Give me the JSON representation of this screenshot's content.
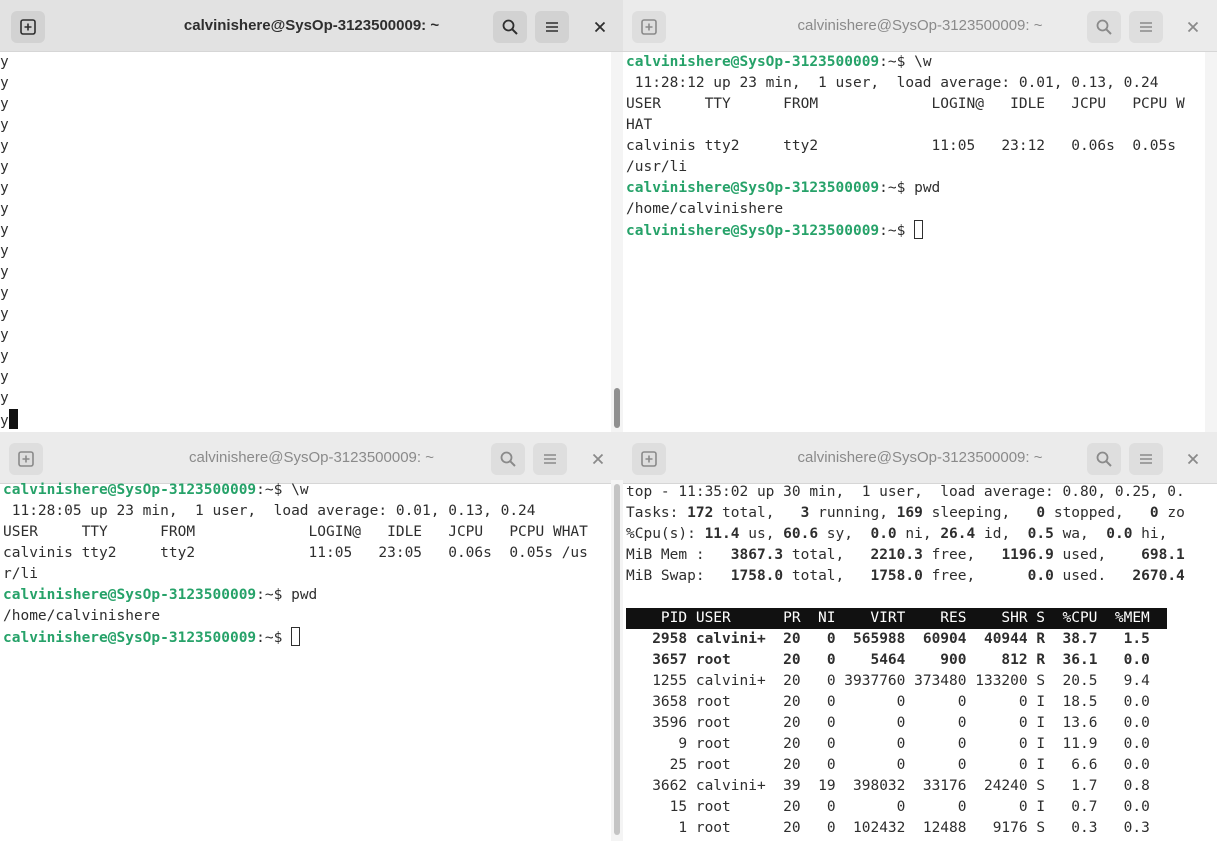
{
  "colors": {
    "prompt": "#26a269",
    "titlebar_active": "#e2e2e2",
    "titlebar_inactive": "#ebebeb",
    "desktop": "#2b2b5a"
  },
  "windows": {
    "top_left": {
      "title": "calvinishere@SysOp-3123500009: ~",
      "active": true,
      "lines": [
        "y",
        "y",
        "y",
        "y",
        "y",
        "y",
        "y",
        "y",
        "y",
        "y",
        "y",
        "y",
        "y",
        "y",
        "y",
        "y",
        "y"
      ],
      "last_line": "y",
      "scroll_position": 0.98
    },
    "top_right": {
      "title": "calvinishere@SysOp-3123500009: ~",
      "active": false,
      "prompt": "calvinishere@SysOp-3123500009",
      "lines": [
        {
          "p": "calvinishere@SysOp-3123500009",
          "t": ":~$ \\w"
        },
        {
          "t": " 11:28:12 up 23 min,  1 user,  load average: 0.01, 0.13, 0.24"
        },
        {
          "t": "USER     TTY      FROM             LOGIN@   IDLE   JCPU   PCPU W"
        },
        {
          "t": "HAT"
        },
        {
          "t": "calvinis tty2     tty2             11:05   23:12   0.06s  0.05s"
        },
        {
          "t": "/usr/li"
        },
        {
          "p": "calvinishere@SysOp-3123500009",
          "t": ":~$ pwd"
        },
        {
          "t": "/home/calvinishere"
        },
        {
          "p": "calvinishere@SysOp-3123500009",
          "t": ":~$ ",
          "cursor": true
        }
      ]
    },
    "bottom_left": {
      "title": "calvinishere@SysOp-3123500009: ~",
      "active": false,
      "lines": [
        {
          "p": "calvinishere@SysOp-3123500009",
          "t": ":~$ \\w"
        },
        {
          "t": " 11:28:05 up 23 min,  1 user,  load average: 0.01, 0.13, 0.24"
        },
        {
          "t": "USER     TTY      FROM             LOGIN@   IDLE   JCPU   PCPU WHAT"
        },
        {
          "t": "calvinis tty2     tty2             11:05   23:05   0.06s  0.05s /us"
        },
        {
          "t": "r/li"
        },
        {
          "p": "calvinishere@SysOp-3123500009",
          "t": ":~$ pwd"
        },
        {
          "t": "/home/calvinishere"
        },
        {
          "p": "calvinishere@SysOp-3123500009",
          "t": ":~$ ",
          "cursor": true
        }
      ]
    },
    "bottom_right": {
      "title": "calvinishere@SysOp-3123500009: ~",
      "active": false,
      "summary": [
        [
          {
            "t": "top - 11:35:02 up 30 min,  1 user,  load average: 0.80, 0.25, 0."
          }
        ],
        [
          {
            "t": "Tasks: "
          },
          {
            "t": "172",
            "b": true
          },
          {
            "t": " total,   "
          },
          {
            "t": "3",
            "b": true
          },
          {
            "t": " running, "
          },
          {
            "t": "169",
            "b": true
          },
          {
            "t": " sleeping,   "
          },
          {
            "t": "0",
            "b": true
          },
          {
            "t": " stopped,   "
          },
          {
            "t": "0",
            "b": true
          },
          {
            "t": " zo"
          }
        ],
        [
          {
            "t": "%Cpu(s): "
          },
          {
            "t": "11.4",
            "b": true
          },
          {
            "t": " us, "
          },
          {
            "t": "60.6",
            "b": true
          },
          {
            "t": " sy,  "
          },
          {
            "t": "0.0",
            "b": true
          },
          {
            "t": " ni, "
          },
          {
            "t": "26.4",
            "b": true
          },
          {
            "t": " id,  "
          },
          {
            "t": "0.5",
            "b": true
          },
          {
            "t": " wa,  "
          },
          {
            "t": "0.0",
            "b": true
          },
          {
            "t": " hi,"
          }
        ],
        [
          {
            "t": "MiB Mem :   "
          },
          {
            "t": "3867.3",
            "b": true
          },
          {
            "t": " total,   "
          },
          {
            "t": "2210.3",
            "b": true
          },
          {
            "t": " free,   "
          },
          {
            "t": "1196.9",
            "b": true
          },
          {
            "t": " used,    "
          },
          {
            "t": "698.1",
            "b": true
          }
        ],
        [
          {
            "t": "MiB Swap:   "
          },
          {
            "t": "1758.0",
            "b": true
          },
          {
            "t": " total,   "
          },
          {
            "t": "1758.0",
            "b": true
          },
          {
            "t": " free,      "
          },
          {
            "t": "0.0",
            "b": true
          },
          {
            "t": " used.   "
          },
          {
            "t": "2670.4",
            "b": true
          }
        ],
        []
      ],
      "table_header": "    PID USER      PR  NI    VIRT    RES    SHR S  %CPU  %MEM  ",
      "processes": [
        {
          "pid": "2958",
          "user": "calvini+",
          "pr": "20",
          "ni": "0",
          "virt": "565988",
          "res": "60904",
          "shr": "40944",
          "s": "R",
          "cpu": "38.7",
          "mem": "1.5",
          "bold": true
        },
        {
          "pid": "3657",
          "user": "root",
          "pr": "20",
          "ni": "0",
          "virt": "5464",
          "res": "900",
          "shr": "812",
          "s": "R",
          "cpu": "36.1",
          "mem": "0.0",
          "bold": true
        },
        {
          "pid": "1255",
          "user": "calvini+",
          "pr": "20",
          "ni": "0",
          "virt": "3937760",
          "res": "373480",
          "shr": "133200",
          "s": "S",
          "cpu": "20.5",
          "mem": "9.4"
        },
        {
          "pid": "3658",
          "user": "root",
          "pr": "20",
          "ni": "0",
          "virt": "0",
          "res": "0",
          "shr": "0",
          "s": "I",
          "cpu": "18.5",
          "mem": "0.0"
        },
        {
          "pid": "3596",
          "user": "root",
          "pr": "20",
          "ni": "0",
          "virt": "0",
          "res": "0",
          "shr": "0",
          "s": "I",
          "cpu": "13.6",
          "mem": "0.0"
        },
        {
          "pid": "9",
          "user": "root",
          "pr": "20",
          "ni": "0",
          "virt": "0",
          "res": "0",
          "shr": "0",
          "s": "I",
          "cpu": "11.9",
          "mem": "0.0"
        },
        {
          "pid": "25",
          "user": "root",
          "pr": "20",
          "ni": "0",
          "virt": "0",
          "res": "0",
          "shr": "0",
          "s": "I",
          "cpu": "6.6",
          "mem": "0.0"
        },
        {
          "pid": "3662",
          "user": "calvini+",
          "pr": "39",
          "ni": "19",
          "virt": "398032",
          "res": "33176",
          "shr": "24240",
          "s": "S",
          "cpu": "1.7",
          "mem": "0.8"
        },
        {
          "pid": "15",
          "user": "root",
          "pr": "20",
          "ni": "0",
          "virt": "0",
          "res": "0",
          "shr": "0",
          "s": "I",
          "cpu": "0.7",
          "mem": "0.0"
        },
        {
          "pid": "1",
          "user": "root",
          "pr": "20",
          "ni": "0",
          "virt": "102432",
          "res": "12488",
          "shr": "9176",
          "s": "S",
          "cpu": "0.3",
          "mem": "0.3"
        }
      ]
    }
  },
  "icons": {
    "new_tab": "new-tab-icon",
    "search": "search-icon",
    "menu": "hamburger-menu-icon",
    "close": "close-icon"
  }
}
